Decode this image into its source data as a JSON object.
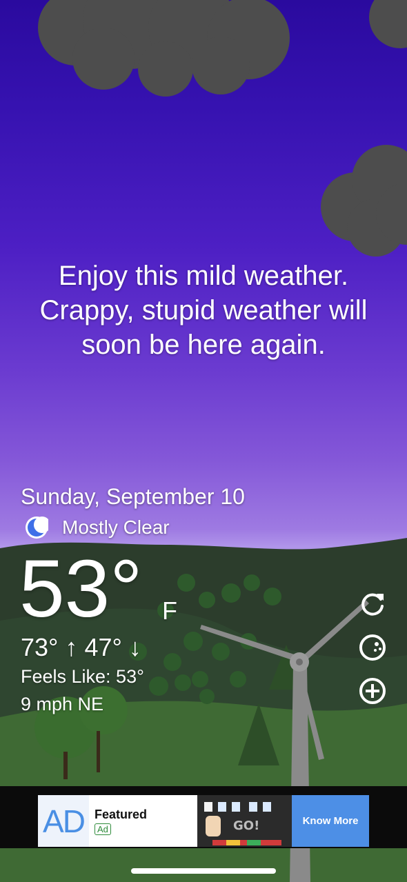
{
  "message": "Enjoy this mild weather.\nCrappy, stupid weather will\nsoon be here again.",
  "current": {
    "date": "Sunday, September 10",
    "condition": "Mostly Clear",
    "condition_icon": "crescent-moon-icon",
    "temperature": "53°",
    "unit": "F",
    "hilo": "73° ↑ 47° ↓",
    "feels_like": "Feels Like: 53°",
    "wind": "9 mph NE"
  },
  "side_buttons": [
    {
      "name": "refresh-icon"
    },
    {
      "name": "radar-icon"
    },
    {
      "name": "add-location-icon"
    }
  ],
  "ad": {
    "logo": "AD",
    "title": "Featured",
    "badge": "Ad",
    "image_text": "GO!",
    "cta": "Know More"
  },
  "colors": {
    "sky_top": "#2a0a9e",
    "sky_bottom": "#b095ea",
    "hills": "#2f4a2c",
    "ad_accent": "#4d8fe6"
  }
}
